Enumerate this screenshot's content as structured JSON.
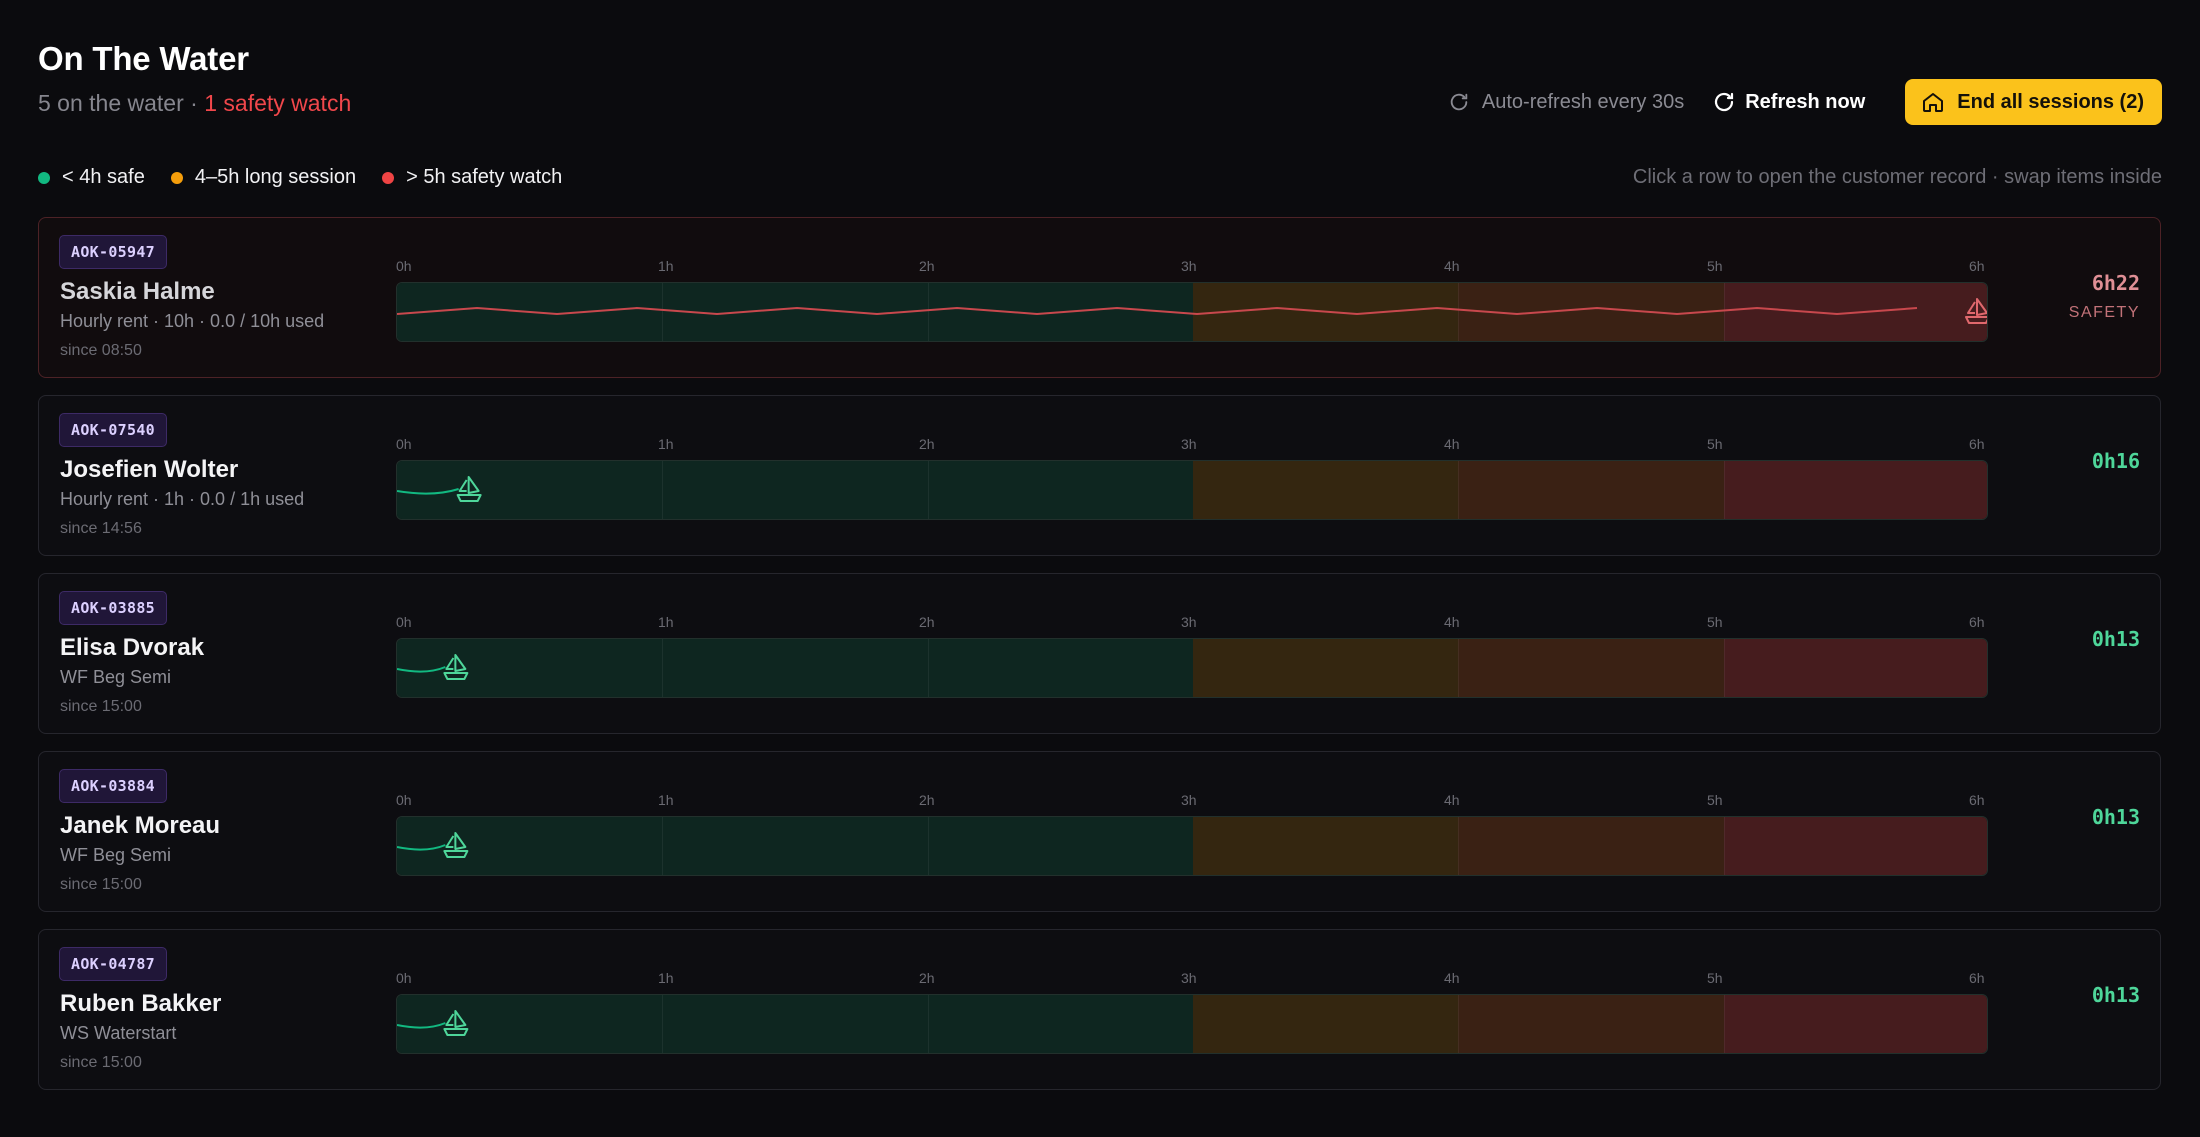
{
  "header": {
    "title": "On The Water",
    "on_water": "5 on the water",
    "separator": " · ",
    "safety_watch": "1 safety watch"
  },
  "toolbar": {
    "auto_refresh": "Auto-refresh every 30s",
    "refresh_label": "Refresh now",
    "end_sessions_label": "End all sessions (2)"
  },
  "legend": [
    {
      "label": "< 4h safe",
      "color": "#12b981"
    },
    {
      "label": "4–5h long session",
      "color": "#f59e0b"
    },
    {
      "label": "> 5h safety watch",
      "color": "#ef4444"
    }
  ],
  "hint": "Click a row to open the customer record · swap items inside",
  "timeline_ticks": [
    "0h",
    "1h",
    "2h",
    "3h",
    "4h",
    "5h",
    "6h"
  ],
  "colors": {
    "safe": "#12b981",
    "long": "#f59e0b",
    "watch": "#ef4444",
    "accent_button": "#fbc21b"
  },
  "sessions": [
    {
      "code": "AOK-05947",
      "name": "Saskia Halme",
      "detail": "Hourly rent · 10h · 0.0 / 10h used",
      "since": "since 08:50",
      "elapsed": "6h22",
      "elapsed_hours": 6.37,
      "status": "SAFETY",
      "state": "safety"
    },
    {
      "code": "AOK-07540",
      "name": "Josefien Wolter",
      "detail": "Hourly rent · 1h · 0.0 / 1h used",
      "since": "since 14:56",
      "elapsed": "0h16",
      "elapsed_hours": 0.27,
      "status": "",
      "state": "safe"
    },
    {
      "code": "AOK-03885",
      "name": "Elisa Dvorak",
      "detail": "WF Beg Semi",
      "since": "since 15:00",
      "elapsed": "0h13",
      "elapsed_hours": 0.22,
      "status": "",
      "state": "safe"
    },
    {
      "code": "AOK-03884",
      "name": "Janek Moreau",
      "detail": "WF Beg Semi",
      "since": "since 15:00",
      "elapsed": "0h13",
      "elapsed_hours": 0.22,
      "status": "",
      "state": "safe"
    },
    {
      "code": "AOK-04787",
      "name": "Ruben Bakker",
      "detail": "WS Waterstart",
      "since": "since 15:00",
      "elapsed": "0h13",
      "elapsed_hours": 0.22,
      "status": "",
      "state": "safe"
    }
  ]
}
